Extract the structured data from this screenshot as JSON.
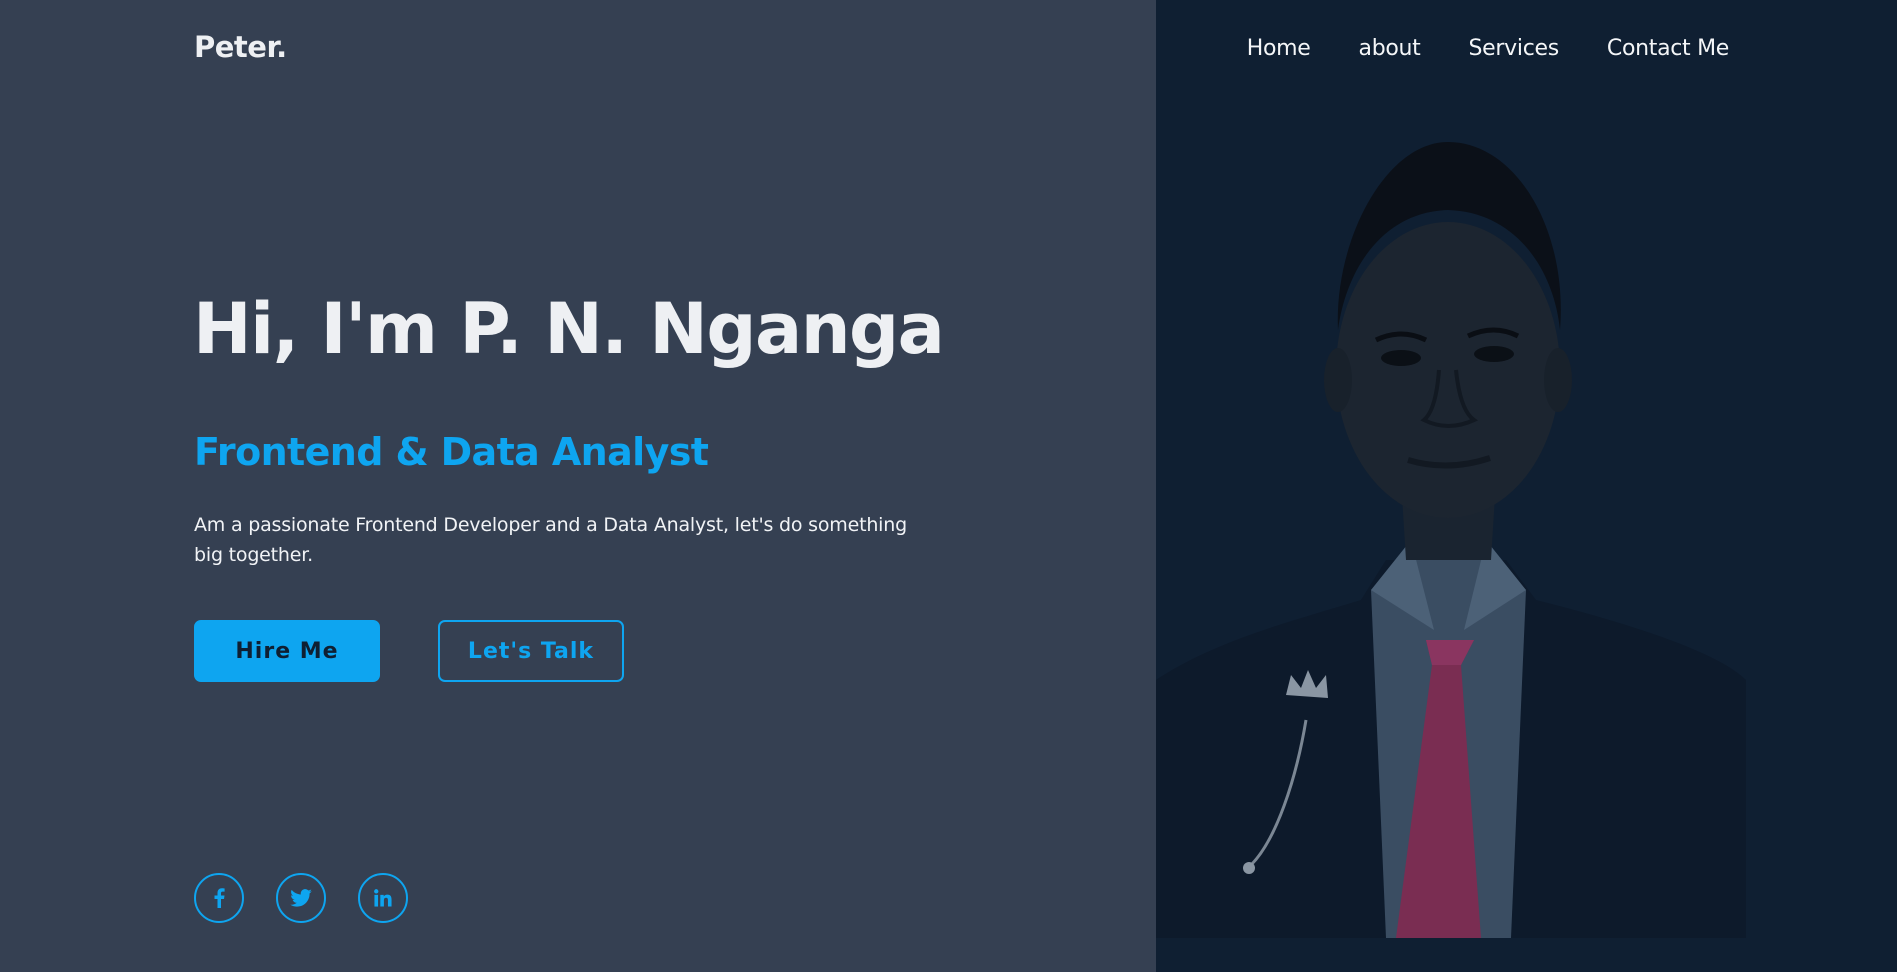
{
  "header": {
    "brand": "Peter.",
    "nav": [
      {
        "label": "Home"
      },
      {
        "label": "about"
      },
      {
        "label": "Services"
      },
      {
        "label": "Contact Me"
      }
    ]
  },
  "hero": {
    "title": "Hi, I'm P. N. Nganga",
    "subtitle": "Frontend & Data Analyst",
    "description": "Am a passionate Frontend Developer and a Data Analyst, let's do something big together.",
    "primary_button": "Hire Me",
    "secondary_button": "Let's Talk"
  },
  "socials": [
    {
      "icon": "facebook-icon"
    },
    {
      "icon": "twitter-icon"
    },
    {
      "icon": "linkedin-icon"
    }
  ],
  "colors": {
    "background": "#354052",
    "panel": "#0f1f32",
    "accent": "#0ea5f0",
    "text": "#eef0f3"
  }
}
